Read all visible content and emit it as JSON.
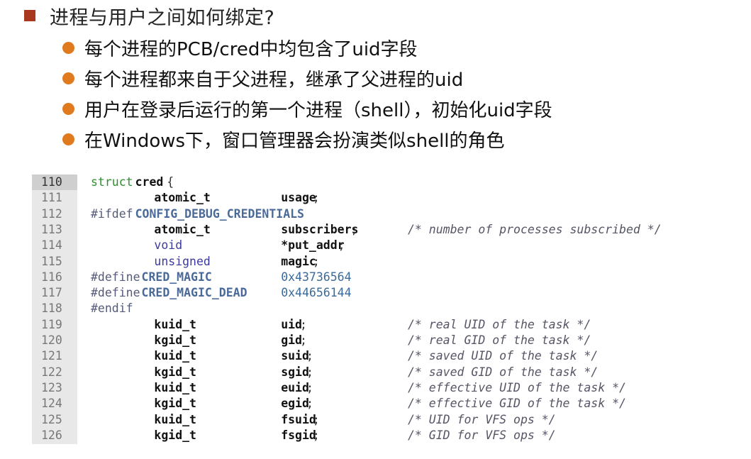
{
  "slide": {
    "title": "进程与用户之间如何绑定?",
    "bullets": [
      "每个进程的PCB/cred中均包含了uid字段",
      "每个进程都来自于父进程，继承了父进程的uid",
      "用户在登录后运行的第一个进程（shell），初始化uid字段",
      "在Windows下，窗口管理器会扮演类似shell的角色"
    ]
  },
  "code": {
    "highlighted_line": "110",
    "lines": [
      {
        "n": "110",
        "t1": "struct",
        "t2": "cred",
        "t3": "{"
      },
      {
        "n": "111",
        "type": "atomic_t",
        "name": "usage",
        "end": ";",
        "comment": ""
      },
      {
        "n": "112",
        "pp": "#ifdef",
        "mac": "CONFIG_DEBUG_CREDENTIALS"
      },
      {
        "n": "113",
        "type": "atomic_t",
        "name": "subscribers",
        "end": ";",
        "comment": "/* number of processes subscribed */"
      },
      {
        "n": "114",
        "type": "void",
        "name": "*put_addr",
        "end": ";",
        "comment": ""
      },
      {
        "n": "115",
        "type": "unsigned",
        "name": "magic",
        "end": ";",
        "comment": ""
      },
      {
        "n": "116",
        "pp": "#define",
        "mac": "CRED_MAGIC",
        "val": "0x43736564"
      },
      {
        "n": "117",
        "pp": "#define",
        "mac": "CRED_MAGIC_DEAD",
        "val": "0x44656144"
      },
      {
        "n": "118",
        "pp": "#endif"
      },
      {
        "n": "119",
        "type": "kuid_t",
        "name": "uid",
        "end": ";",
        "comment": "/* real UID of the task */"
      },
      {
        "n": "120",
        "type": "kgid_t",
        "name": "gid",
        "end": ";",
        "comment": "/* real GID of the task */"
      },
      {
        "n": "121",
        "type": "kuid_t",
        "name": "suid",
        "end": ";",
        "comment": "/* saved UID of the task */"
      },
      {
        "n": "122",
        "type": "kgid_t",
        "name": "sgid",
        "end": ";",
        "comment": "/* saved GID of the task */"
      },
      {
        "n": "123",
        "type": "kuid_t",
        "name": "euid",
        "end": ";",
        "comment": "/* effective UID of the task */"
      },
      {
        "n": "124",
        "type": "kgid_t",
        "name": "egid",
        "end": ";",
        "comment": "/* effective GID of the task */"
      },
      {
        "n": "125",
        "type": "kuid_t",
        "name": "fsuid",
        "end": ";",
        "comment": "/* UID for VFS ops */"
      },
      {
        "n": "126",
        "type": "kgid_t",
        "name": "fsgid",
        "end": ";",
        "comment": "/* GID for VFS ops */"
      }
    ]
  }
}
